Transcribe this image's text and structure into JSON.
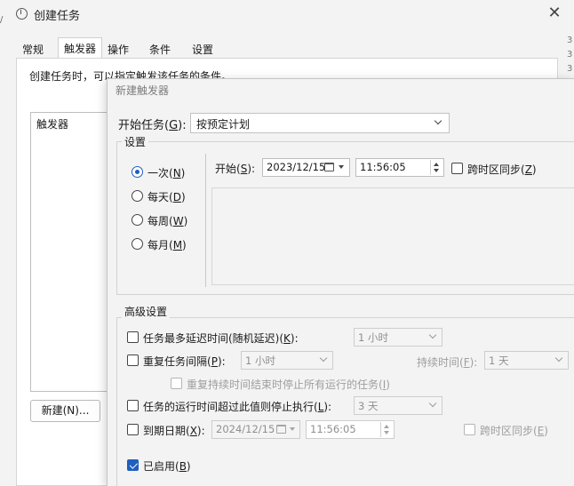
{
  "background_window": {
    "title": "创建任务",
    "close_glyph": "✕",
    "edge_glyph": "/",
    "right_edge_digits": [
      "3",
      "3",
      "3"
    ],
    "tabs": [
      {
        "label": "常规",
        "active": false
      },
      {
        "label": "触发器",
        "active": true
      },
      {
        "label": "操作",
        "active": false
      },
      {
        "label": "条件",
        "active": false
      },
      {
        "label": "设置",
        "active": false
      }
    ],
    "description": "创建任务时，可以指定触发该任务的条件。",
    "trigger_list_header": "触发器",
    "new_button_label": "新建(N)..."
  },
  "dialog": {
    "title": "新建触发器",
    "begin_task": {
      "label_prefix": "开始任务(",
      "accesskey": "G",
      "label_suffix": "):",
      "value": "按预定计划"
    },
    "settings": {
      "legend": "设置",
      "schedule_options": [
        {
          "prefix": "一次(",
          "key": "N",
          "suffix": ")",
          "checked": true
        },
        {
          "prefix": "每天(",
          "key": "D",
          "suffix": ")",
          "checked": false
        },
        {
          "prefix": "每周(",
          "key": "W",
          "suffix": ")",
          "checked": false
        },
        {
          "prefix": "每月(",
          "key": "M",
          "suffix": ")",
          "checked": false
        }
      ],
      "start_prefix": "开始(",
      "start_key": "S",
      "start_suffix": "):",
      "date": "2023/12/15",
      "time": "11:56:05",
      "sync_prefix": "跨时区同步(",
      "sync_key": "Z",
      "sync_suffix": ")",
      "sync_checked": false
    },
    "advanced": {
      "legend": "高级设置",
      "delay": {
        "prefix": "任务最多延迟时间(随机延迟)(",
        "key": "K",
        "suffix": "):",
        "checked": false,
        "value": "1 小时"
      },
      "repeat": {
        "prefix": "重复任务间隔(",
        "key": "P",
        "suffix": "):",
        "checked": false,
        "value": "1 小时",
        "duration_prefix": "持续时间(",
        "duration_key": "F",
        "duration_suffix": "):",
        "duration_value": "1 天"
      },
      "stop_all": {
        "prefix": "重复持续时间结束时停止所有运行的任务(",
        "key": "I",
        "suffix": ")",
        "checked": false
      },
      "stop_longer": {
        "prefix": "任务的运行时间超过此值则停止执行(",
        "key": "L",
        "suffix": "):",
        "checked": false,
        "value": "3 天"
      },
      "expire": {
        "prefix": "到期日期(",
        "key": "X",
        "suffix": "):",
        "checked": false,
        "date": "2024/12/15",
        "time": "11:56:05",
        "sync_prefix": "跨时区同步(",
        "sync_key": "E",
        "sync_suffix": ")"
      },
      "enabled": {
        "prefix": "已启用(",
        "key": "B",
        "suffix": ")",
        "checked": true
      }
    }
  },
  "colors": {
    "accent": "#1f5fbf",
    "window_bg": "#f3f3f3",
    "disabled_text": "#9e9e9e"
  }
}
